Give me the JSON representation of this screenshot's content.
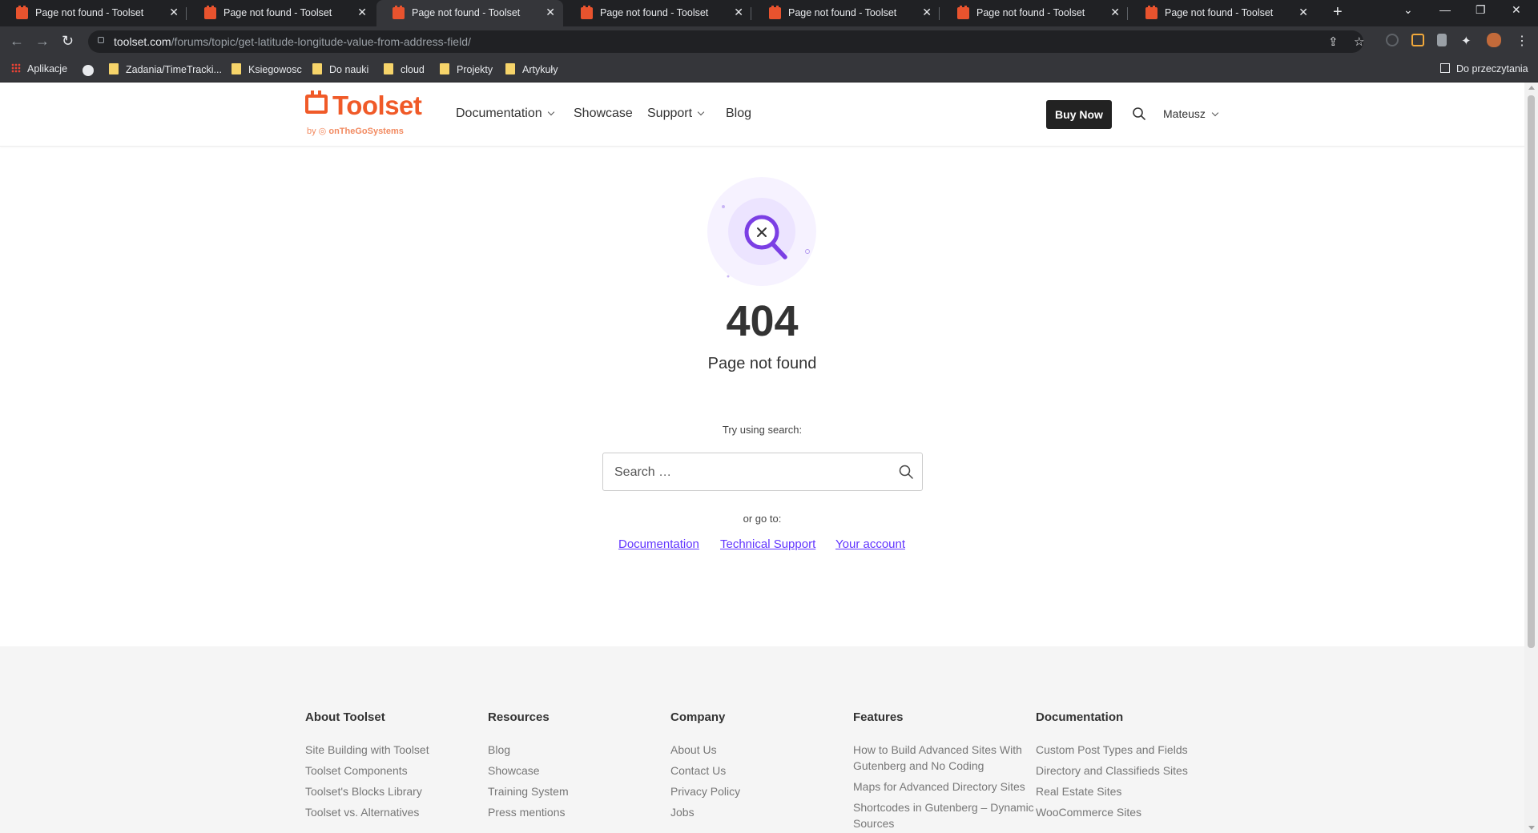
{
  "browser": {
    "tabs": [
      {
        "title": "Page not found - Toolset"
      },
      {
        "title": "Page not found - Toolset"
      },
      {
        "title": "Page not found - Toolset"
      },
      {
        "title": "Page not found - Toolset"
      },
      {
        "title": "Page not found - Toolset"
      },
      {
        "title": "Page not found - Toolset"
      },
      {
        "title": "Page not found - Toolset"
      }
    ],
    "active_tab": 2,
    "url_domain": "toolset.com",
    "url_path": "/forums/topic/get-latitude-longitude-value-from-address-field/",
    "bookmarks": [
      "Aplikacje",
      "Zadania/TimeTracki...",
      "Ksiegowosc",
      "Do nauki",
      "cloud",
      "Projekty",
      "Artykuły"
    ],
    "reading_list": "Do przeczytania"
  },
  "header": {
    "logo_word": "Toolset",
    "logo_by": "by",
    "logo_company": "onTheGoSystems",
    "nav": [
      "Documentation",
      "Showcase",
      "Support",
      "Blog"
    ],
    "buy_label": "Buy Now",
    "user_name": "Mateusz"
  },
  "main": {
    "code": "404",
    "message": "Page not found",
    "try_search": "Try using search:",
    "search_placeholder": "Search …",
    "or_go_to": "or go to:",
    "links": [
      "Documentation",
      "Technical Support",
      "Your account"
    ]
  },
  "footer": {
    "columns": [
      {
        "title": "About Toolset",
        "items": [
          "Site Building with Toolset",
          "Toolset Components",
          "Toolset's Blocks Library",
          "Toolset vs. Alternatives"
        ]
      },
      {
        "title": "Resources",
        "items": [
          "Blog",
          "Showcase",
          "Training System",
          "Press mentions"
        ]
      },
      {
        "title": "Company",
        "items": [
          "About Us",
          "Contact Us",
          "Privacy Policy",
          "Jobs"
        ]
      },
      {
        "title": "Features",
        "items": [
          "How to Build Advanced Sites With Gutenberg and No Coding",
          "Maps for Advanced Directory Sites",
          "Shortcodes in Gutenberg – Dynamic Sources"
        ]
      },
      {
        "title": "Documentation",
        "items": [
          "Custom Post Types and Fields",
          "Directory and Classifieds Sites",
          "Real Estate Sites",
          "WooCommerce Sites"
        ]
      }
    ]
  },
  "colors": {
    "brand": "#f05a28",
    "link": "#6236ff",
    "accent_purple": "#7b3fe4"
  }
}
